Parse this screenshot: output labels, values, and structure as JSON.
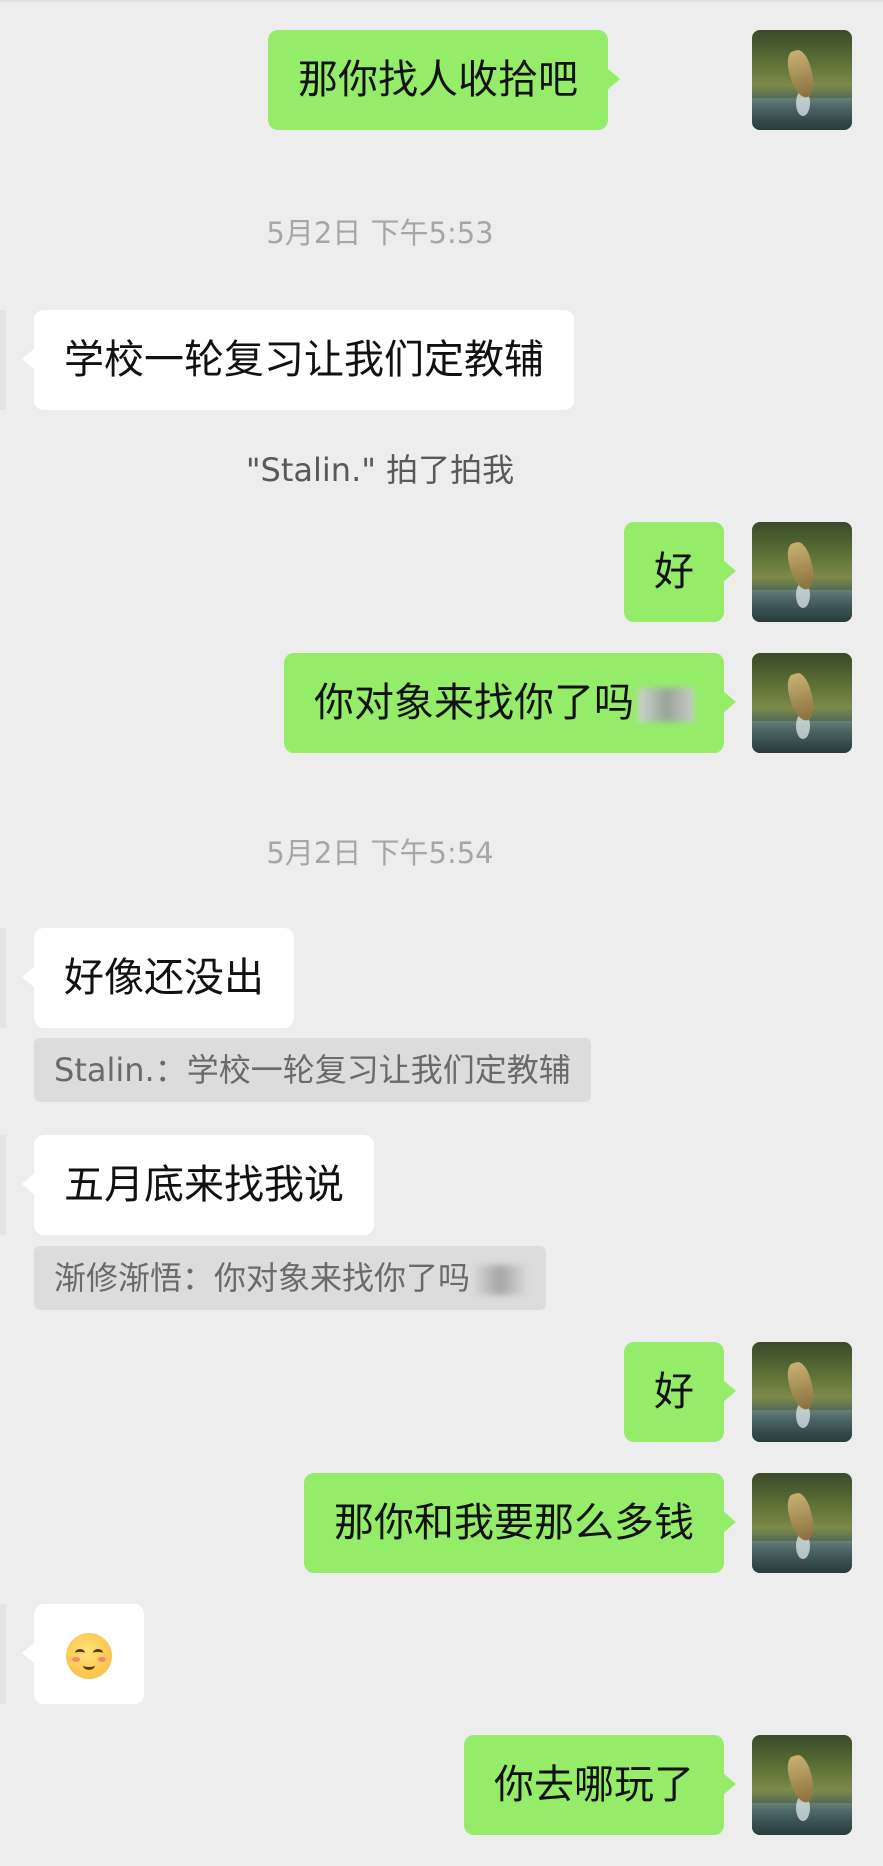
{
  "messages": {
    "m1": "那你找人收拾吧",
    "t1": "5月2日 下午5:53",
    "m2": "学校一轮复习让我们定教辅",
    "sys1": "\"Stalin.\" 拍了拍我",
    "m3": "好",
    "m4": "你对象来找你了吗",
    "t2": "5月2日 下午5:54",
    "m5": "好像还没出",
    "q1": "Stalin.：学校一轮复习让我们定教辅",
    "m6": "五月底来找我说",
    "q2": "渐修渐悟：你对象来找你了吗",
    "m7": "好",
    "m8": "那你和我要那么多钱",
    "m9_icon": "shy-smile-emoji",
    "m10": "你去哪玩了"
  },
  "colors": {
    "background": "#ededed",
    "outgoing_bubble": "#95ec69",
    "incoming_bubble": "#ffffff",
    "timestamp": "#a6a6a6",
    "quote_bg": "#dcdcdc"
  }
}
